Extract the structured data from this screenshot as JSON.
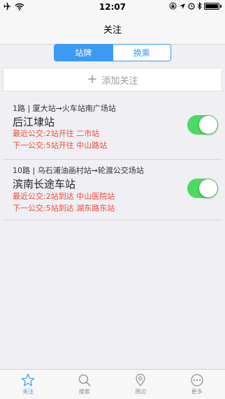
{
  "status": {
    "time": "12:07"
  },
  "nav": {
    "title": "关注"
  },
  "segmented": {
    "stations": "站牌",
    "transfer": "换乘"
  },
  "add_follow": {
    "label": "添加关注"
  },
  "follows": [
    {
      "route": "1路 | 厦大站➞火车站南广场站",
      "station": "后江埭站",
      "nearest": "最近公交:2站开往  二市站",
      "next": "下一公交:5站开往  中山路站",
      "enabled": true
    },
    {
      "route": "10路 | 乌石浦油画村站➞轮渡公交场站",
      "station": "滨南长途车站",
      "nearest": "最近公交:2站到达  中山医院站",
      "next": "下一公交:5站到达  湖东路东站",
      "enabled": true
    }
  ],
  "tabs": [
    {
      "label": "关注",
      "icon": "star-icon",
      "active": true
    },
    {
      "label": "搜索",
      "icon": "search-icon",
      "active": false
    },
    {
      "label": "周边",
      "icon": "location-pin-icon",
      "active": false
    },
    {
      "label": "更多",
      "icon": "more-icon",
      "active": false
    }
  ],
  "colors": {
    "accent": "#3a9af4",
    "alert": "#f04a36",
    "toggle_on": "#4cd964"
  }
}
